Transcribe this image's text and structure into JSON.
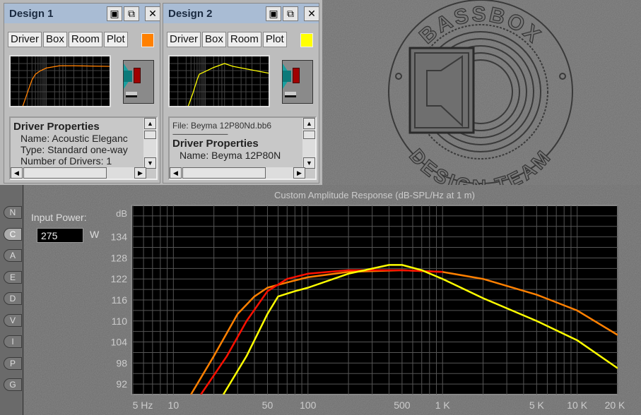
{
  "designs": [
    {
      "title": "Design 1",
      "tabs": [
        "Driver",
        "Box",
        "Room",
        "Plot"
      ],
      "color": "#ff8000",
      "info_lines": [
        "Driver Properties",
        "Name: Acoustic Eleganc",
        "Type: Standard one-way",
        "Number of Drivers: 1"
      ],
      "mini_curve": [
        [
          5,
          80
        ],
        [
          14,
          89
        ],
        [
          20,
          100
        ],
        [
          30,
          112
        ],
        [
          40,
          117
        ],
        [
          60,
          120
        ],
        [
          100,
          122.5
        ],
        [
          300,
          124.5
        ],
        [
          1000,
          124.5
        ],
        [
          20000,
          124
        ]
      ]
    },
    {
      "title": "Design 2",
      "tabs": [
        "Driver",
        "Box",
        "Room",
        "Plot"
      ],
      "color": "#ffff00",
      "info_lines": [
        "File: Beyma 12P80Nd.bb6",
        "---------------------------------------",
        "Driver Properties",
        "Name: Beyma 12P80N"
      ],
      "mini_curve": [
        [
          5,
          80
        ],
        [
          24,
          89
        ],
        [
          35,
          100
        ],
        [
          50,
          112
        ],
        [
          60,
          117
        ],
        [
          100,
          119.5
        ],
        [
          200,
          123
        ],
        [
          500,
          126.5
        ],
        [
          1000,
          124
        ],
        [
          20000,
          118
        ]
      ]
    }
  ],
  "titlebar_icons": [
    "save-icon",
    "copy-icon",
    "close-icon"
  ],
  "logo": {
    "top_text": "BASSBOX",
    "bottom_text": "DESIGN TEAM"
  },
  "sidebar": [
    "N",
    "C",
    "A",
    "E",
    "D",
    "V",
    "I",
    "P",
    "G"
  ],
  "sidebar_active": "C",
  "input_power": {
    "label": "Input Power:",
    "value": "275",
    "unit": "W"
  },
  "chart_data": {
    "type": "line",
    "title": "Custom Amplitude Response (dB-SPL/Hz at 1 m)",
    "ylabel": "dB",
    "xscale": "log",
    "xlim": [
      5,
      20000
    ],
    "ylim": [
      89,
      143
    ],
    "grid": true,
    "x_tick_labels": [
      [
        "5 Hz",
        5
      ],
      [
        "10",
        10
      ],
      [
        "50",
        50
      ],
      [
        "100",
        100
      ],
      [
        "500",
        500
      ],
      [
        "1 K",
        1000
      ],
      [
        "5 K",
        5000
      ],
      [
        "10 K",
        10000
      ],
      [
        "20 K",
        20000
      ]
    ],
    "y_ticks": [
      134,
      128,
      122,
      116,
      110,
      104,
      98,
      92
    ],
    "series": [
      {
        "color": "#ff8000",
        "points": [
          [
            13.5,
            89
          ],
          [
            20,
            100
          ],
          [
            30,
            112
          ],
          [
            40,
            117
          ],
          [
            50,
            119.5
          ],
          [
            70,
            121
          ],
          [
            100,
            122.5
          ],
          [
            200,
            124
          ],
          [
            500,
            124.5
          ],
          [
            1000,
            124
          ],
          [
            2000,
            122
          ],
          [
            5000,
            117.5
          ],
          [
            10000,
            113
          ],
          [
            20000,
            106
          ]
        ]
      },
      {
        "color": "#ff1000",
        "points": [
          [
            16,
            89
          ],
          [
            25,
            100
          ],
          [
            35,
            110
          ],
          [
            50,
            118.5
          ],
          [
            70,
            122
          ],
          [
            100,
            123.5
          ],
          [
            200,
            124.5
          ],
          [
            500,
            124.5
          ],
          [
            1000,
            124
          ]
        ]
      },
      {
        "color": "#ffff00",
        "points": [
          [
            23.5,
            89
          ],
          [
            35,
            100
          ],
          [
            50,
            112
          ],
          [
            60,
            117
          ],
          [
            80,
            118.5
          ],
          [
            100,
            119.5
          ],
          [
            200,
            123.5
          ],
          [
            400,
            126
          ],
          [
            500,
            126
          ],
          [
            700,
            124.5
          ],
          [
            1000,
            122
          ],
          [
            2000,
            116.5
          ],
          [
            5000,
            110
          ],
          [
            10000,
            104.5
          ],
          [
            20000,
            96.5
          ]
        ]
      }
    ]
  }
}
